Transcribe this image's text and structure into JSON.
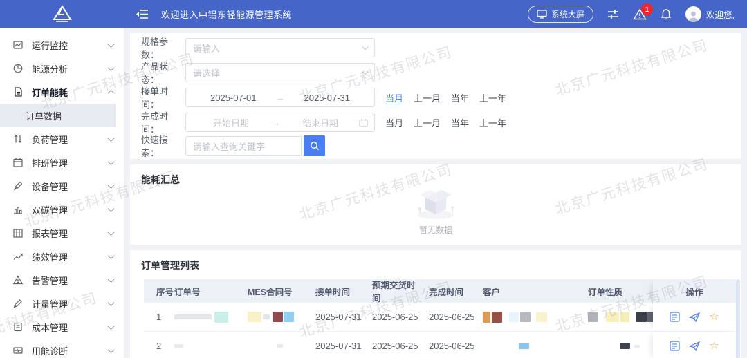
{
  "watermark": {
    "text": "北京广元科技有限公司"
  },
  "header": {
    "title": "欢迎进入中铝东轻能源管理系统",
    "big_screen_label": "系统大屏",
    "alarm_badge": "1",
    "welcome": "欢迎您,"
  },
  "sidebar": {
    "items": [
      {
        "label": "运行监控"
      },
      {
        "label": "能源分析"
      },
      {
        "label": "订单能耗"
      },
      {
        "label": "负荷管理"
      },
      {
        "label": "排班管理"
      },
      {
        "label": "设备管理"
      },
      {
        "label": "双碳管理"
      },
      {
        "label": "报表管理"
      },
      {
        "label": "绩效管理"
      },
      {
        "label": "告警管理"
      },
      {
        "label": "计量管理"
      },
      {
        "label": "成本管理"
      },
      {
        "label": "用能诊断"
      }
    ],
    "submenu_selected": "订单数据"
  },
  "filters": {
    "spec_label": "规格参数：",
    "spec_placeholder": "请输入",
    "status_label": "产品状态：",
    "status_placeholder": "请选择",
    "receive_label": "接单时间：",
    "receive_start": "2025-07-01",
    "receive_end": "2025-07-31",
    "finish_label": "完成时间：",
    "finish_start_placeholder": "开始日期",
    "finish_end_placeholder": "结束日期",
    "arrow": "→",
    "quick_links": [
      "当月",
      "上一月",
      "当年",
      "上一年"
    ],
    "search_label": "快速搜索：",
    "search_placeholder": "请输入查询关键字"
  },
  "summary": {
    "title": "能耗汇总",
    "empty_text": "暂无数据"
  },
  "icons": {
    "favorite_star": "☆"
  },
  "table": {
    "title": "订单管理列表",
    "columns": [
      "序号",
      "订单号",
      "MES合同号",
      "接单时间",
      "预期交货时间",
      "完成时间",
      "客户",
      "订单性质",
      "操作"
    ],
    "rows": [
      {
        "seq": "1",
        "receive": "2025-07-31",
        "expected": "2025-06-25",
        "finish": "2025-06-25",
        "order_masks": [
          {
            "c": "#e4e7ea",
            "w": 54,
            "h": 7,
            "m": 4
          },
          {
            "c": "#c9efe9",
            "w": 20,
            "h": 16
          }
        ],
        "mes_masks": [
          {
            "c": "#f8f1c9",
            "w": 20,
            "h": 15,
            "m": 2
          },
          {
            "c": "#e4e7ea",
            "w": 10,
            "h": 7,
            "m": 4
          },
          {
            "c": "#8e4a50",
            "w": 15,
            "h": 15,
            "m": 1
          },
          {
            "c": "#92cdf2",
            "w": 15,
            "h": 15
          }
        ],
        "customer_masks": [
          {
            "c": "#dd9a55",
            "w": 11,
            "h": 16
          },
          {
            "c": "#9a4f44",
            "w": 15,
            "h": 16,
            "m": 10
          },
          {
            "c": "#e8f3fb",
            "w": 14,
            "h": 14,
            "m": 2
          },
          {
            "c": "#b6b9bf",
            "w": 15,
            "h": 14,
            "m": 8
          },
          {
            "c": "#f9f2cd",
            "w": 16,
            "h": 14
          }
        ],
        "nature_masks": [
          {
            "c": "#b0b3ba",
            "w": 14,
            "h": 14,
            "m": 12
          },
          {
            "c": "#f8efbd",
            "w": 19,
            "h": 14,
            "m": 2
          },
          {
            "c": "#f5ecb8",
            "w": 13,
            "h": 14,
            "m": 10
          },
          {
            "c": "#3b3f4a",
            "w": 15,
            "h": 15,
            "m": 1
          },
          {
            "c": "#5f636d",
            "w": 13,
            "h": 15
          }
        ]
      },
      {
        "seq": "2",
        "receive": "2025-07-31",
        "expected": "2025-06-25",
        "finish": "2025-06-25",
        "order_masks": [
          {
            "c": "#e9eaec",
            "w": 13,
            "h": 5
          }
        ],
        "mes_masks": [
          {
            "c": "transparent",
            "w": 40,
            "h": 1
          },
          {
            "c": "#e9eaec",
            "w": 9,
            "h": 5
          }
        ],
        "customer_masks": [
          {
            "c": "transparent",
            "w": 50,
            "h": 1
          },
          {
            "c": "#85c6f3",
            "w": 15,
            "h": 9
          }
        ],
        "nature_masks": [
          {
            "c": "transparent",
            "w": 44,
            "h": 1
          },
          {
            "c": "#3f424c",
            "w": 15,
            "h": 9,
            "m": 6
          },
          {
            "c": "#e9eaec",
            "w": 8,
            "h": 4
          }
        ]
      }
    ]
  }
}
